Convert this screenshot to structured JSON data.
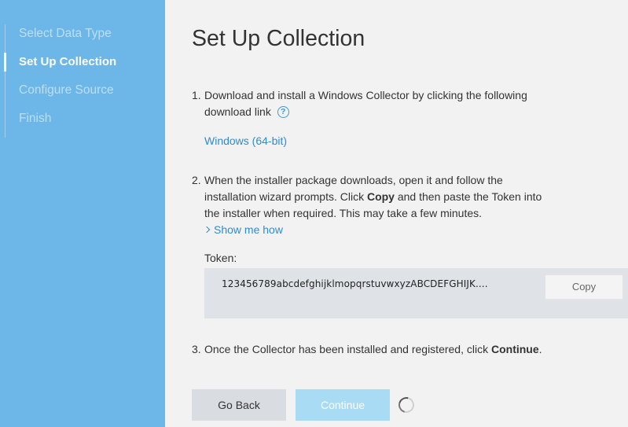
{
  "sidebar": {
    "steps": [
      {
        "label": "Select Data Type"
      },
      {
        "label": "Set Up Collection"
      },
      {
        "label": "Configure Source"
      },
      {
        "label": "Finish"
      }
    ]
  },
  "main": {
    "title": "Set Up Collection",
    "step1": {
      "number": "1.",
      "text": "Download and install a Windows Collector by clicking the following download link",
      "help_icon": "question-circle-icon",
      "download_link": "Windows (64-bit)"
    },
    "step2": {
      "number": "2.",
      "text_before": "When the installer package downloads, open it and follow the installation wizard prompts. Click ",
      "text_bold": "Copy",
      "text_after": " and then paste the Token into the installer when required. This may take a few minutes.",
      "show_me_how": "Show me how",
      "token_label": "Token:",
      "token_value": "123456789abcdefghijklmopqrstuvwxyzABCDEFGHIJK....",
      "copy_label": "Copy"
    },
    "step3": {
      "number": "3.",
      "text_before": "Once the Collector has been installed and registered, click ",
      "text_bold": "Continue",
      "text_after": "."
    },
    "buttons": {
      "back": "Go Back",
      "continue": "Continue"
    }
  },
  "colors": {
    "sidebar_bg": "#6cb7e8",
    "link": "#2e8ccf",
    "continue_disabled": "#a9dbf5"
  }
}
